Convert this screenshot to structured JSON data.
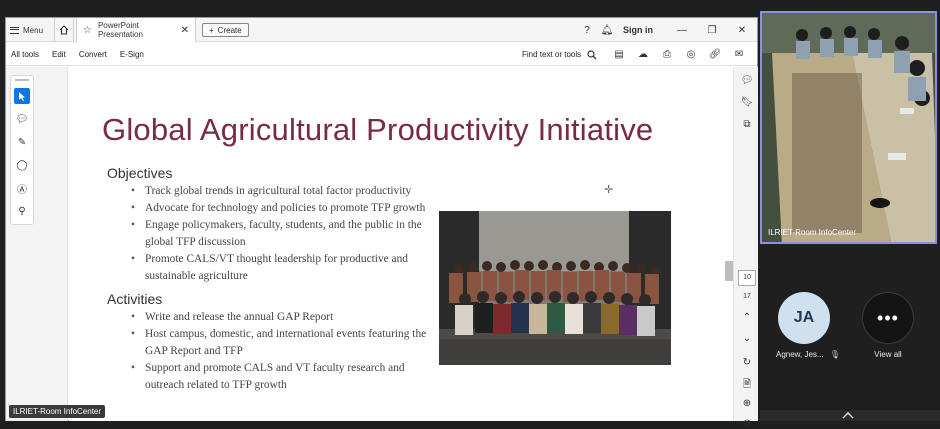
{
  "acrobat": {
    "titlebar": {
      "menu_label": "Menu",
      "tab_title": "PowerPoint Presentation",
      "tab_close": "✕",
      "create_label": "Create",
      "signin_label": "Sign in"
    },
    "toolbar": {
      "menu_items": [
        "All tools",
        "Edit",
        "Convert",
        "E-Sign"
      ],
      "find_label": "Find text or tools"
    },
    "slide": {
      "title": "Global Agricultural Productivity Initiative",
      "objectives_heading": "Objectives",
      "objectives": [
        "Track global trends in agricultural total factor productivity",
        "Advocate for technology and policies to promote TFP growth",
        "Engage policymakers, faculty, students, and the public in the global TFP discussion",
        "Promote CALS/VT thought leadership for productive and sustainable agriculture"
      ],
      "activities_heading": "Activities",
      "activities": [
        "Write and release the annual GAP Report",
        "Host campus, domestic, and international events featuring the GAP Report and TFP",
        "Support and promote CALS and VT faculty research and outreach related to TFP growth"
      ]
    },
    "pagination": {
      "current": "10",
      "total": "17"
    },
    "screen_share_label": "ILRIET-Room InfoCenter"
  },
  "meeting": {
    "video_tile_label": "ILRIET-Room InfoCenter",
    "participant": {
      "initials": "JA",
      "name": "Agnew, Jes..."
    },
    "view_all_label": "View all",
    "colors": {
      "tile_border": "#8b8fe5",
      "avatar_bg": "#cfe0ee"
    }
  }
}
